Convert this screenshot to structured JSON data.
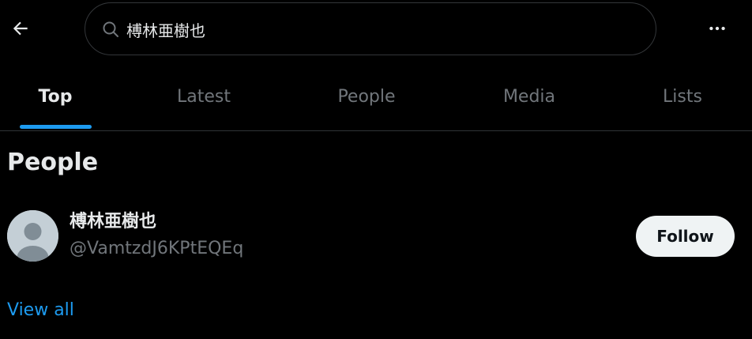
{
  "header": {
    "back_icon": "arrow-left-icon",
    "search_icon": "search-icon",
    "search_value": "榑林亜樹也",
    "more_icon": "more-horizontal-icon"
  },
  "tabs": [
    {
      "label": "Top",
      "active": true
    },
    {
      "label": "Latest",
      "active": false
    },
    {
      "label": "People",
      "active": false
    },
    {
      "label": "Media",
      "active": false
    },
    {
      "label": "Lists",
      "active": false
    }
  ],
  "people_section": {
    "title": "People",
    "users": [
      {
        "display_name": "榑林亜樹也",
        "handle": "@VamtzdJ6KPtEQEq",
        "follow_label": "Follow",
        "avatar": "default-avatar-icon"
      }
    ],
    "view_all_label": "View all"
  },
  "colors": {
    "background": "#000000",
    "text_primary": "#e7e9ea",
    "text_secondary": "#71767b",
    "accent": "#1d9bf0",
    "follow_button_bg": "#eff3f4"
  }
}
